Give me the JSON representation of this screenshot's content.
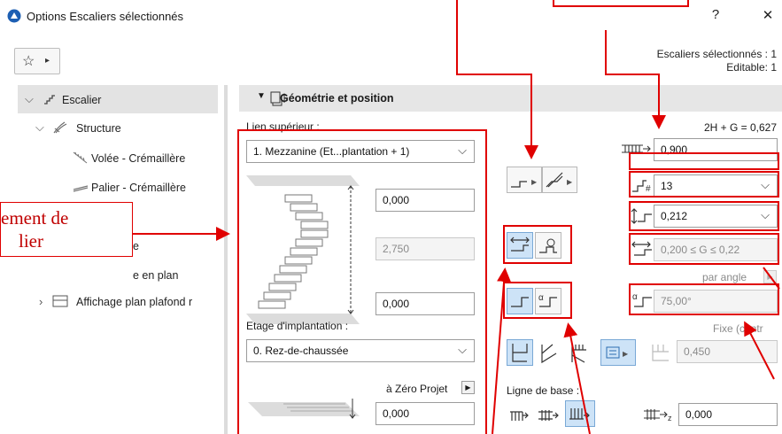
{
  "window": {
    "title": "Options Escaliers sélectionnés",
    "help": "?",
    "close": "✕"
  },
  "header_info": {
    "selected": "Escaliers sélectionnés : 1",
    "editable": "Editable: 1"
  },
  "favorites": {
    "star": "☆",
    "arrow": "▸"
  },
  "tree": {
    "escalier": "Escalier",
    "structure": "Structure",
    "volee": "Volée - Crémaillère",
    "palier": "Palier - Crémaillère",
    "row5": "e",
    "row6": "e en plan",
    "affichage": "Affichage plan plafond r"
  },
  "callout": {
    "line1": "ement de",
    "line2": "lier"
  },
  "section": {
    "title": "Géométrie et position"
  },
  "left_col": {
    "top_link_label": "Lien supérieur :",
    "top_link_value": "1. Mezzanine (Et...plantation + 1)",
    "top_offset": "0,000",
    "height": "2,750",
    "bottom_offset": "0,000",
    "home_story_label": "Etage d'implantation :",
    "home_story_value": "0. Rez-de-chaussée",
    "zero_label": "à Zéro Projet",
    "zero_value": "0,000"
  },
  "right_col": {
    "formula": "2H + G = 0,627",
    "width": "0,900",
    "risers": "13",
    "riser_height": "0,212",
    "tread_range": "0,200 ≤ G ≤ 0,22",
    "par_angle": "par angle",
    "angle": "75,00°",
    "fixe": "Fixe (centr",
    "width2": "0,450",
    "baseline_label": "Ligne de base :",
    "baseline_value": "0,000"
  },
  "colors": {
    "annotation": "#e00000",
    "selected_button": "#cde3f7",
    "section_header": "#e6e6e6"
  }
}
